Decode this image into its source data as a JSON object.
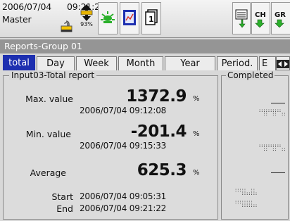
{
  "header": {
    "date": "2006/07/04",
    "time": "09:21:21",
    "user": "Master",
    "memory_percent": "93%",
    "icons": [
      "lock-icon",
      "memory-card-icon",
      "alarm-icon",
      "data-display-icon",
      "file-icon",
      "report-icon",
      "channel-copy-icon",
      "group-copy-icon"
    ]
  },
  "title": "Reports-Group 01",
  "tabs": [
    "total",
    "Day",
    "Week",
    "Month",
    "Year",
    "Period.",
    "E"
  ],
  "active_tab": "total",
  "report": {
    "legend": "Input03-Total report",
    "max": {
      "label": "Max. value",
      "value": "1372.9",
      "unit": "%",
      "timestamp": "2006/07/04  09:12:08"
    },
    "min": {
      "label": "Min. value",
      "value": "-201.4",
      "unit": "%",
      "timestamp": "2006/07/04  09:15:33"
    },
    "avg": {
      "label": "Average",
      "value": "625.3",
      "unit": "%"
    },
    "start": {
      "label": "Start",
      "timestamp": "2006/07/04  09:05:31"
    },
    "end": {
      "label": "End",
      "timestamp": "2006/07/04  09:21:22"
    }
  },
  "completed": {
    "legend": "Completed"
  },
  "colors": {
    "tab_active": "#1d2fb0",
    "title_bar": "#959595",
    "alarm_icon": "#2bb02b",
    "memory_card": "#e8b400"
  }
}
